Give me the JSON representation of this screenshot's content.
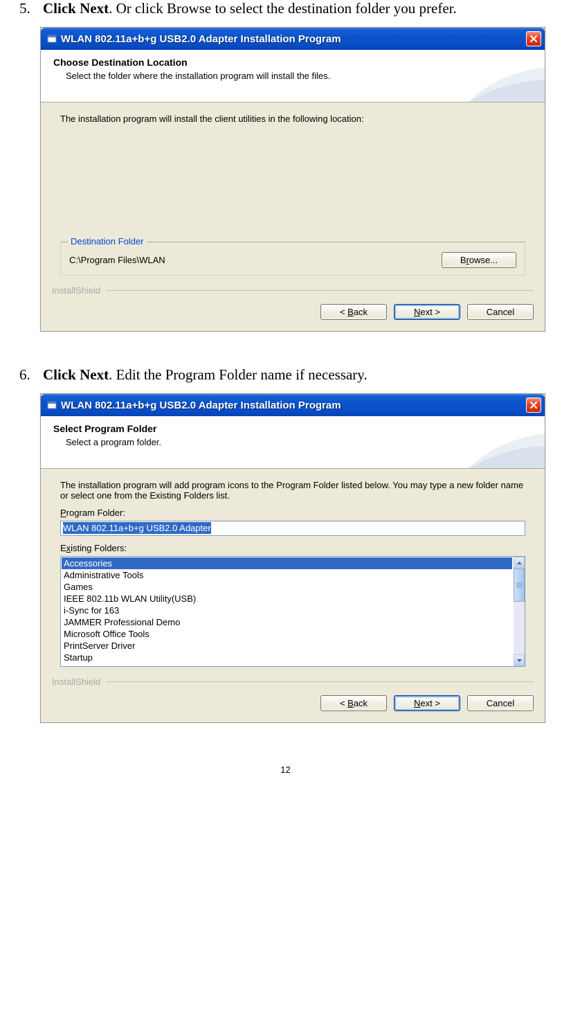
{
  "page_number": "12",
  "step5": {
    "num": "5.",
    "bold": "Click Next",
    "rest": ". Or click Browse to select the destination folder you prefer."
  },
  "step6": {
    "num": "6.",
    "bold": "Click Next",
    "rest": ". Edit the Program Folder name if necessary."
  },
  "dialog_title": "WLAN 802.11a+b+g USB2.0 Adapter Installation Program",
  "close_glyph": "X",
  "d1": {
    "header_title": "Choose Destination Location",
    "header_sub": "Select the folder where the installation program will install the files.",
    "body_text": "The installation program will install the client utilities in the following location:",
    "dest_legend": "Destination Folder",
    "dest_path": "C:\\Program Files\\WLAN",
    "browse_pre": "B",
    "browse_u": "r",
    "browse_post": "owse..."
  },
  "brand": "InstallShield",
  "back_pre": "< ",
  "back_u": "B",
  "back_post": "ack",
  "next_u": "N",
  "next_post": "ext >",
  "cancel": "Cancel",
  "d2": {
    "header_title": "Select Program Folder",
    "header_sub": "Select a program folder.",
    "body_text": "The installation program will add program icons to the Program Folder listed below. You may type a new folder name or select one from the Existing Folders list.",
    "pf_label_u": "P",
    "pf_label_post": "rogram Folder:",
    "pf_value": "WLAN 802.11a+b+g USB2.0 Adapter",
    "ef_label_pre": "E",
    "ef_label_u": "x",
    "ef_label_post": "isting Folders:",
    "items": [
      "Accessories",
      "Administrative Tools",
      "Games",
      "IEEE 802.11b WLAN Utility(USB)",
      "i-Sync for 163",
      "JAMMER Professional Demo",
      "Microsoft Office Tools",
      "PrintServer Driver",
      "Startup"
    ]
  }
}
